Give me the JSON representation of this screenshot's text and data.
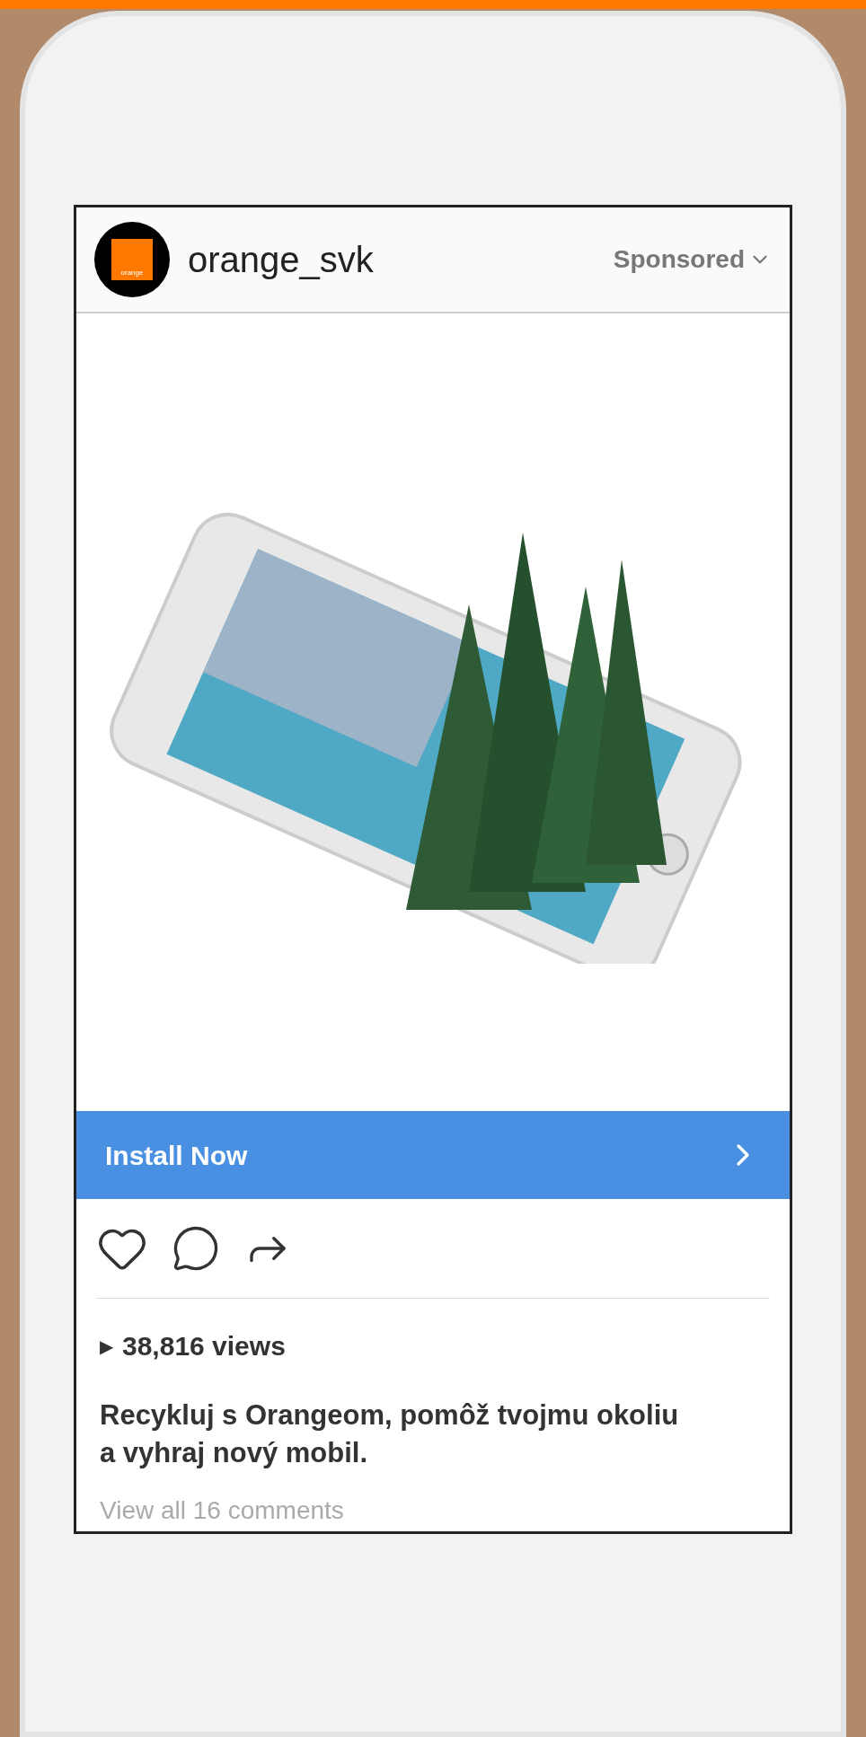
{
  "post": {
    "account": "orange_svk",
    "logo_text": "orange",
    "sponsored": "Sponsored",
    "cta": "Install Now",
    "views_marker": "▶",
    "views": "38,816 views",
    "caption": "Recykluj s Orangeom, pomôž tvojmu okoliu a vyhraj nový mobil.",
    "comments_link": "View all 16 comments"
  }
}
